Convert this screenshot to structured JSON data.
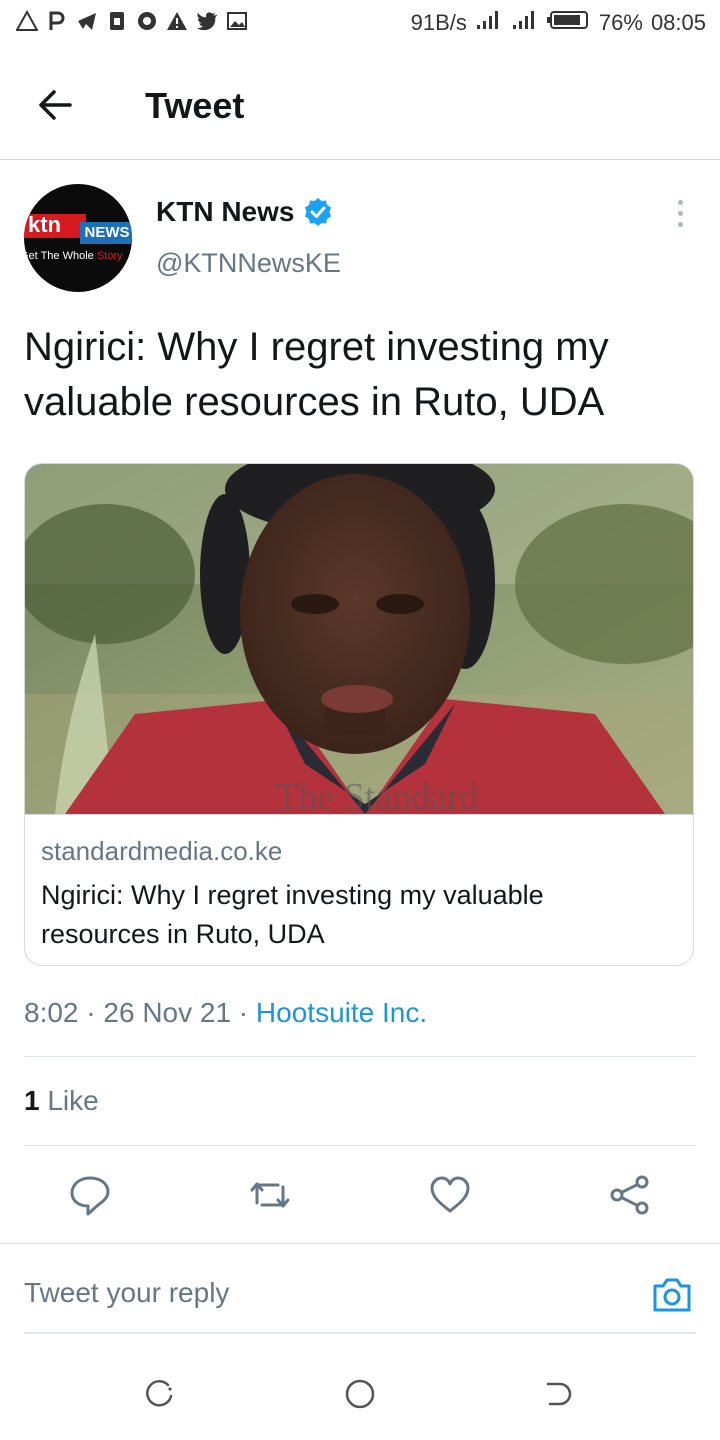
{
  "status_bar": {
    "left_icons": [
      "warning-icon",
      "p-icon",
      "telegram-icon",
      "sim-icon",
      "chrome-icon",
      "alert-icon",
      "twitter-icon",
      "image-icon"
    ],
    "network_speed": "91B/s",
    "battery": "76%",
    "time": "08:05"
  },
  "app_bar": {
    "title": "Tweet"
  },
  "tweet": {
    "author": {
      "name": "KTN News",
      "handle": "@KTNNewsKE",
      "verified": true,
      "avatar": {
        "logo": "ktn",
        "news": "NEWS",
        "tagline_start": "Get The Whole ",
        "tagline_end": "Story"
      }
    },
    "text": "Ngirici: Why I regret investing my valuable resources in Ruto, UDA",
    "card": {
      "domain": "standardmedia.co.ke",
      "title": "Ngirici: Why I regret investing my valuable resources in Ruto, UDA",
      "image_desc": "photo-woman-red-blazer"
    },
    "time": "8:02",
    "date": "26 Nov 21",
    "via": "Hootsuite Inc.",
    "like_count": "1",
    "like_label": "Like"
  },
  "reply": {
    "placeholder": "Tweet your reply"
  },
  "colors": {
    "accent": "#1b95e0",
    "secondary_text": "#657786",
    "primary_text": "#14171a",
    "divider": "#e1e8ed"
  }
}
